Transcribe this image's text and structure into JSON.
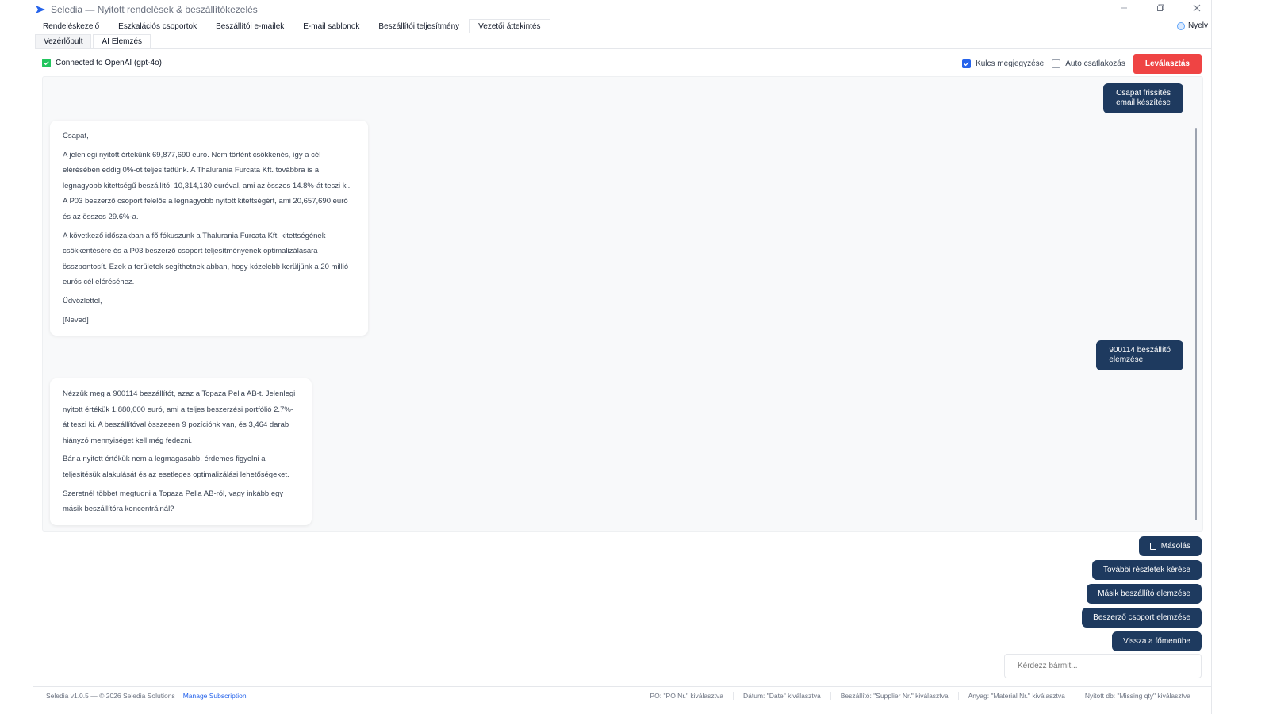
{
  "window": {
    "title": "Seledia — Nyitott rendelések & beszállítókezelés"
  },
  "tabs": [
    {
      "label": "Rendeléskezelő"
    },
    {
      "label": "Eszkalációs csoportok"
    },
    {
      "label": "Beszállítói e-mailek"
    },
    {
      "label": "E-mail sablonok"
    },
    {
      "label": "Beszállítói teljesítmény"
    },
    {
      "label": "Vezetői áttekintés"
    }
  ],
  "language_label": "Nyelv",
  "subtabs": [
    {
      "label": "Vezérlőpult"
    },
    {
      "label": "AI Elemzés"
    }
  ],
  "connection": {
    "status": "Connected to OpenAI (gpt-4o)",
    "remember_key": "Kulcs megjegyzése",
    "auto_connect": "Auto csatlakozás",
    "disconnect": "Leválasztás"
  },
  "chat": {
    "user_msg_1": [
      "Csapat frissítés",
      "email készítése"
    ],
    "ai_msg_1": [
      "Csapat,",
      "A jelenlegi nyitott értékünk 69,877,690 euró. Nem történt csökkenés, így a cél elérésében eddig 0%-ot teljesítettünk. A Thalurania Furcata Kft. továbbra is a legnagyobb kitettségű beszállító, 10,314,130 euróval, ami az összes 14.8%-át teszi ki. A P03 beszerző csoport felelős a legnagyobb nyitott kitettségért, ami 20,657,690 euró és az összes 29.6%-a.",
      "A következő időszakban a fő fókuszunk a Thalurania Furcata Kft. kitettségének csökkentésére és a P03 beszerző csoport teljesítményének optimalizálására összpontosít. Ezek a területek segíthetnek abban, hogy közelebb kerüljünk a 20 millió eurós cél eléréséhez.",
      "Üdvözlettel,",
      "[Neved]"
    ],
    "user_msg_2": [
      "900114 beszállító",
      "elemzése"
    ],
    "ai_msg_2": [
      "Nézzük meg a 900114 beszállítót, azaz a Topaza Pella AB-t. Jelenlegi nyitott értékük 1,880,000 euró, ami a teljes beszerzési portfólió 2.7%-át teszi ki. A beszállítóval összesen 9 pozíciónk van, és 3,464 darab hiányzó mennyiséget kell még fedezni.",
      "Bár a nyitott értékük nem a legmagasabb, érdemes figyelni a teljesítésük alakulását és az esetleges optimalizálási lehetőségeket.",
      "Szeretnél többet megtudni a Topaza Pella AB-ról, vagy inkább egy másik beszállítóra koncentrálnál?"
    ]
  },
  "actions": {
    "copy": "Másolás",
    "more_details": "További részletek kérése",
    "other_supplier": "Másik beszállító elemzése",
    "purchasing_group": "Beszerző csoport elemzése",
    "back": "Vissza a főmenübe"
  },
  "input": {
    "placeholder": "Kérdezz bármit..."
  },
  "status": {
    "version": "Seledia v1.0.5 — © 2026 Seledia Solutions",
    "manage": "Manage Subscription",
    "po": "PO: \"PO Nr.\" kiválasztva",
    "date": "Dátum: \"Date\" kiválasztva",
    "supplier": "Beszállító: \"Supplier Nr.\" kiválasztva",
    "material": "Anyag: \"Material Nr.\" kiválasztva",
    "missing": "Nyitott db: \"Missing qty\" kiválasztva"
  },
  "colors": {
    "accent": "#1e3a5f",
    "danger": "#ef4444",
    "success": "#22c55e",
    "checkbox": "#2563eb"
  }
}
